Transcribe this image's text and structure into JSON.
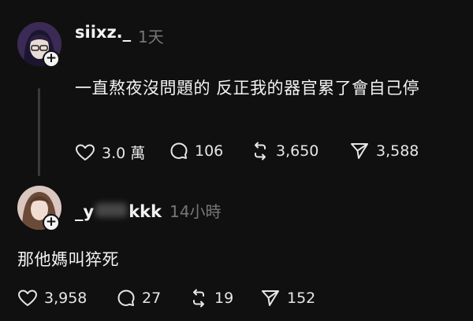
{
  "post": {
    "username": "siixz._",
    "time": "1天",
    "text": "一直熬夜沒問題的 反正我的器官累了會自己停",
    "likes": "3.0 萬",
    "replies": "106",
    "reposts": "3,650",
    "shares": "3,588"
  },
  "reply": {
    "username": "_y",
    "username_end": "kkk",
    "time": "14小時",
    "text": "那他媽叫猝死",
    "likes": "3,958",
    "replies": "27",
    "reposts": "19",
    "shares": "152"
  },
  "icons": {
    "like": "heart-icon",
    "reply": "speech-bubble-icon",
    "repost": "repost-arrows-icon",
    "share": "send-icon",
    "follow": "plus-icon"
  },
  "colors": {
    "background": "#101010",
    "text": "#f3f3f3",
    "muted": "#777777",
    "thread_line": "#3a3a3a"
  }
}
